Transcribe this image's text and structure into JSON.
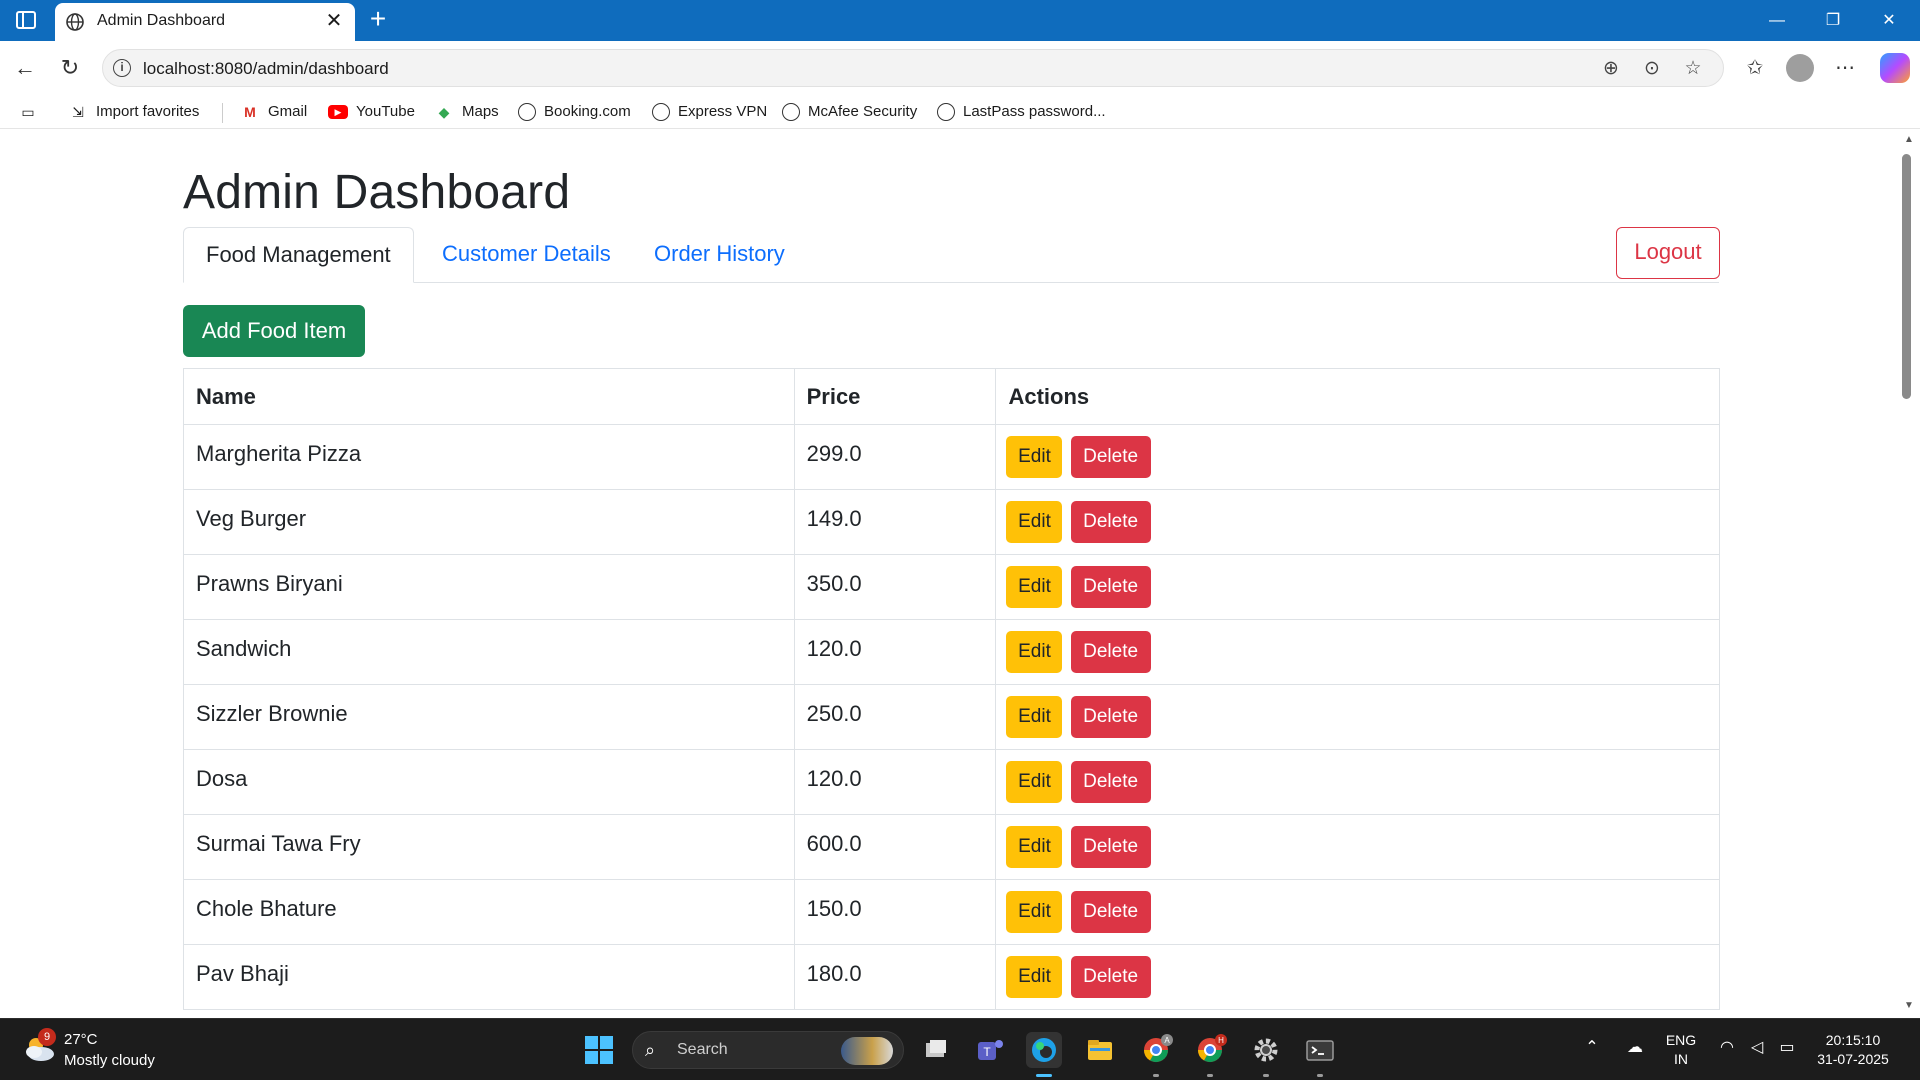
{
  "browser": {
    "tab_title": "Admin Dashboard",
    "url": "localhost:8080/admin/dashboard",
    "bookmarks": [
      {
        "label": "Import favorites",
        "icon": "import-icon"
      },
      {
        "label": "Gmail",
        "icon": "gmail-icon"
      },
      {
        "label": "YouTube",
        "icon": "youtube-icon"
      },
      {
        "label": "Maps",
        "icon": "maps-icon"
      },
      {
        "label": "Booking.com",
        "icon": "globe-icon"
      },
      {
        "label": "Express VPN",
        "icon": "globe-icon"
      },
      {
        "label": "McAfee Security",
        "icon": "globe-icon"
      },
      {
        "label": "LastPass password...",
        "icon": "globe-icon"
      }
    ]
  },
  "page": {
    "title": "Admin Dashboard",
    "tabs": [
      {
        "label": "Food Management",
        "active": true
      },
      {
        "label": "Customer Details",
        "active": false
      },
      {
        "label": "Order History",
        "active": false
      }
    ],
    "logout_label": "Logout",
    "add_button_label": "Add Food Item",
    "table": {
      "headers": [
        "Name",
        "Price",
        "Actions"
      ],
      "edit_label": "Edit",
      "delete_label": "Delete",
      "rows": [
        {
          "name": "Margherita Pizza",
          "price": "299.0"
        },
        {
          "name": "Veg Burger",
          "price": "149.0"
        },
        {
          "name": "Prawns Biryani",
          "price": "350.0"
        },
        {
          "name": "Sandwich",
          "price": "120.0"
        },
        {
          "name": "Sizzler Brownie",
          "price": "250.0"
        },
        {
          "name": "Dosa",
          "price": "120.0"
        },
        {
          "name": "Surmai Tawa Fry",
          "price": "600.0"
        },
        {
          "name": "Chole Bhature",
          "price": "150.0"
        },
        {
          "name": "Pav Bhaji",
          "price": "180.0"
        }
      ]
    }
  },
  "taskbar": {
    "weather_badge": "9",
    "weather_temp": "27°C",
    "weather_desc": "Mostly cloudy",
    "search_placeholder": "Search",
    "lang_top": "ENG",
    "lang_bottom": "IN",
    "time": "20:15:10",
    "date": "31-07-2025"
  },
  "colors": {
    "titlebar": "#0f6cbd",
    "link": "#0d6efd",
    "success": "#198754",
    "warning": "#ffc107",
    "danger": "#dc3545"
  }
}
